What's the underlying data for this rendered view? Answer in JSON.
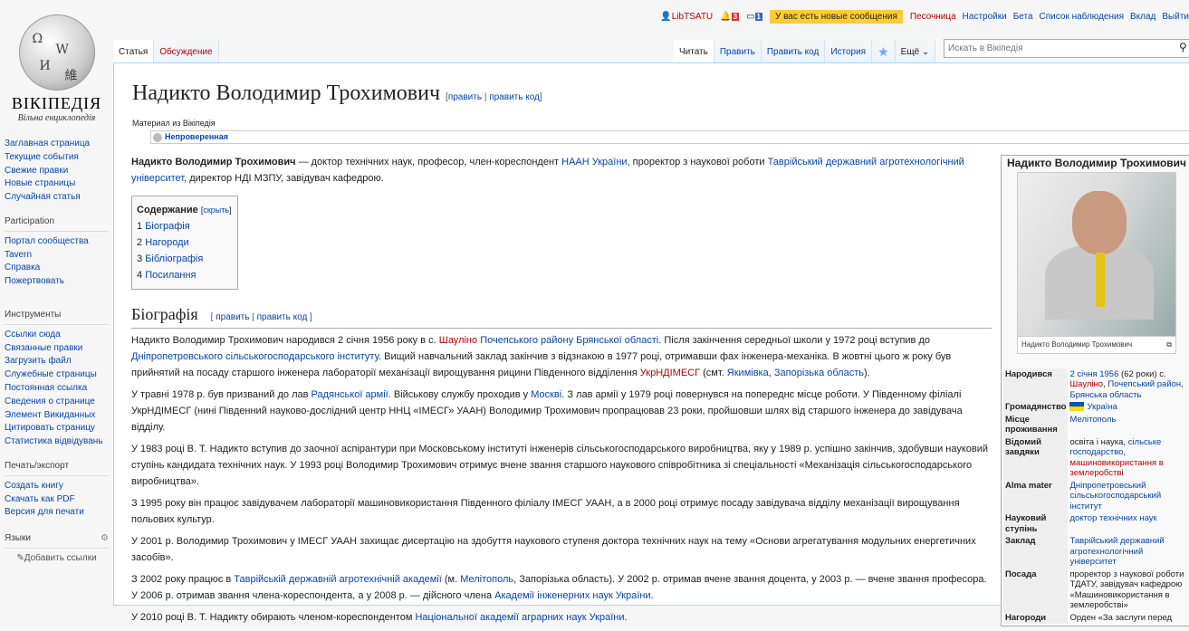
{
  "logo": {
    "wordmark": "ВІКІПЕДІЯ",
    "tagline": "Вільна енциклопедія"
  },
  "sidebar": {
    "nav": [
      "Заглавная страница",
      "Текущие события",
      "Свежие правки",
      "Новые страницы",
      "Случайная статья"
    ],
    "participation": {
      "heading": "Participation",
      "items": [
        "Портал сообщества",
        "Tavern",
        "Справка",
        "Пожертвовать"
      ]
    },
    "tools": {
      "heading": "Инструменты",
      "items": [
        "Ссылки сюда",
        "Связанные правки",
        "Загрузить файл",
        "Служебные страницы",
        "Постоянная ссылка",
        "Сведения о странице",
        "Элемент Викиданных",
        "Цитировать страницу",
        "Статистика відвідувань"
      ]
    },
    "print": {
      "heading": "Печать/экспорт",
      "items": [
        "Создать книгу",
        "Скачать как PDF",
        "Версия для печати"
      ]
    },
    "languages": {
      "heading": "Языки",
      "add": "Добавить ссылки"
    }
  },
  "personal": {
    "user": "LibTSATU",
    "alerts": "3",
    "notices": "1",
    "new_messages": "У вас есть новые сообщения",
    "links": [
      "Песочница",
      "Настройки",
      "Бета",
      "Список наблюдения",
      "Вклад",
      "Выйти"
    ]
  },
  "tabs": {
    "left": [
      "Статья",
      "Обсуждение"
    ],
    "right": [
      "Читать",
      "Править",
      "Править код",
      "История"
    ],
    "more": "Ещё"
  },
  "search": {
    "placeholder": "Искать в Вікіпедія"
  },
  "page": {
    "title": "Надикто Володимир Трохимович",
    "edit": "править",
    "edit_code": "править код",
    "from": "Материал из Вікіпедія",
    "flag": "Непроверенная",
    "lead": [
      {
        "t": "Надикто Володимир Трохимович",
        "b": 1
      },
      {
        "t": " — доктор технічних наук, професор, член-кореспондент "
      },
      {
        "t": "НААН України",
        "l": 1
      },
      {
        "t": ", проректор з наукової роботи "
      },
      {
        "t": "Таврійський державний агротехнологічний університет",
        "l": 1
      },
      {
        "t": ", директор НДІ МЗПУ, завідувач кафедрою."
      }
    ],
    "toc": {
      "title": "Содержание",
      "hide": "скрыть",
      "items": [
        {
          "n": "1",
          "t": "Біографія"
        },
        {
          "n": "2",
          "t": "Нагороди"
        },
        {
          "n": "3",
          "t": "Бібліографія"
        },
        {
          "n": "4",
          "t": "Посилання"
        }
      ]
    },
    "section": "Біографія",
    "paragraphs": [
      [
        {
          "t": "Надикто Володимир Трохимович народився 2 січня 1956 року в с. "
        },
        {
          "t": "Шауліно",
          "r": 1
        },
        {
          "t": " "
        },
        {
          "t": "Почепського району",
          "l": 1
        },
        {
          "t": " "
        },
        {
          "t": "Брянської області",
          "l": 1
        },
        {
          "t": ". Після закінчення середньої школи у 1972 році вступив до "
        },
        {
          "t": "Дніпропетровського сільськогосподарського інституту",
          "l": 1
        },
        {
          "t": ". Вищий навчальний заклад закінчив з відзнакою в 1977 році, отримавши фах інженера-механіка. В жовтні цього ж року був прийнятий на посаду старшого інженера лабораторії механізації вирощування рицини Південного відділення "
        },
        {
          "t": "УкрНДІМЕСГ",
          "r": 1
        },
        {
          "t": " (смт. "
        },
        {
          "t": "Якимівка",
          "l": 1
        },
        {
          "t": ", "
        },
        {
          "t": "Запорізька область",
          "l": 1
        },
        {
          "t": ")."
        }
      ],
      [
        {
          "t": "У травні 1978 р. був призваний до лав "
        },
        {
          "t": "Радянської армії",
          "l": 1
        },
        {
          "t": ". Військову службу проходив у "
        },
        {
          "t": "Москві",
          "l": 1
        },
        {
          "t": ". З лав армії у 1979 році повернувся на попереднє місце роботи. У Південному філіалі УкрНДІМЕСГ (нині Південний науково-дослідний центр ННЦ «ІМЕСГ» УААН) Володимир Трохимович пропрацював 23 роки, пройшовши шлях від старшого інженера до завідувача відділу."
        }
      ],
      [
        {
          "t": "У 1983 році В. Т. Надикто вступив до заочної аспірантури при Московському інституті інженерів сільськогосподарського виробництва, яку у 1989 р. успішно закінчив, здобувши науковий ступінь кандидата технічних наук. У 1993 році Володимир Трохимович отримує вчене звання старшого наукового співробітника зі спеціальності «Механізація сільськогосподарського виробництва»."
        }
      ],
      [
        {
          "t": "З 1995 року він працює завідувачем лабораторії машиновикористання Південного філіалу ІМЕСГ УААН, а в 2000 році отримує посаду завідувача відділу механізації вирощування польових культур."
        }
      ],
      [
        {
          "t": "У 2001 р. Володимир Трохимович у ІМЕСГ УААН захищає дисертацію на здобуття наукового ступеня доктора технічних наук на тему «Основи агрегатування модульних енергетичних засобів»."
        }
      ],
      [
        {
          "t": "З 2002 року працює в "
        },
        {
          "t": "Таврійській державній агротехнічній академії",
          "l": 1
        },
        {
          "t": " (м. "
        },
        {
          "t": "Мелітополь",
          "l": 1
        },
        {
          "t": ", Запорізька область). У 2002 р. отримав вчене звання доцента, у 2003 р. — вчене звання професора. У 2006 р. отримав звання члена-кореспондента, а у 2008 р. — дійсного члена "
        },
        {
          "t": "Академії інженерних наук України",
          "l": 1
        },
        {
          "t": "."
        }
      ],
      [
        {
          "t": "У 2010 році В. Т. Надикту обирають членом-кореспондентом "
        },
        {
          "t": "Національної академії аграрних наук України",
          "l": 1
        },
        {
          "t": "."
        }
      ]
    ]
  },
  "infobox": {
    "name": "Надикто Володимир Трохимович",
    "caption": "Надикто Володимир Трохимович",
    "rows": [
      {
        "k": "Народився",
        "v": [
          {
            "t": "2 січня 1956",
            "l": 1
          },
          {
            "t": " (62 роки) с. "
          },
          {
            "t": "Шауліно",
            "r": 1
          },
          {
            "t": ", "
          },
          {
            "t": "Почепський район",
            "l": 1
          },
          {
            "t": ", "
          },
          {
            "t": "Брянська область",
            "l": 1
          }
        ]
      },
      {
        "k": "Громадянство",
        "flag": 1,
        "v": [
          {
            "t": "Україна",
            "l": 1
          }
        ]
      },
      {
        "k": "Місце проживання",
        "v": [
          {
            "t": "Мелітополь",
            "l": 1
          }
        ]
      },
      {
        "k": "Відомий завдяки",
        "v": [
          {
            "t": "освіта і наука, "
          },
          {
            "t": "сільське господарство",
            "l": 1
          },
          {
            "t": ", "
          },
          {
            "t": "машиновикористання в землеробстві",
            "r": 1
          }
        ]
      },
      {
        "k": "Alma mater",
        "v": [
          {
            "t": "Дніпропетровський сільськогосподарський інститут",
            "l": 1
          }
        ]
      },
      {
        "k": "Науковий ступінь",
        "v": [
          {
            "t": "доктор технічних наук",
            "l": 1
          }
        ]
      },
      {
        "k": "Заклад",
        "v": [
          {
            "t": "Таврійський державний агротехнологічний університет",
            "l": 1
          }
        ]
      },
      {
        "k": "Посада",
        "v": [
          {
            "t": "проректор з наукової роботи ТДАТУ, завідувач кафедрою «Машиновикористання в землеробстві»"
          }
        ]
      },
      {
        "k": "Нагороди",
        "v": [
          {
            "t": "Орден «За заслуги перед"
          }
        ]
      }
    ]
  }
}
